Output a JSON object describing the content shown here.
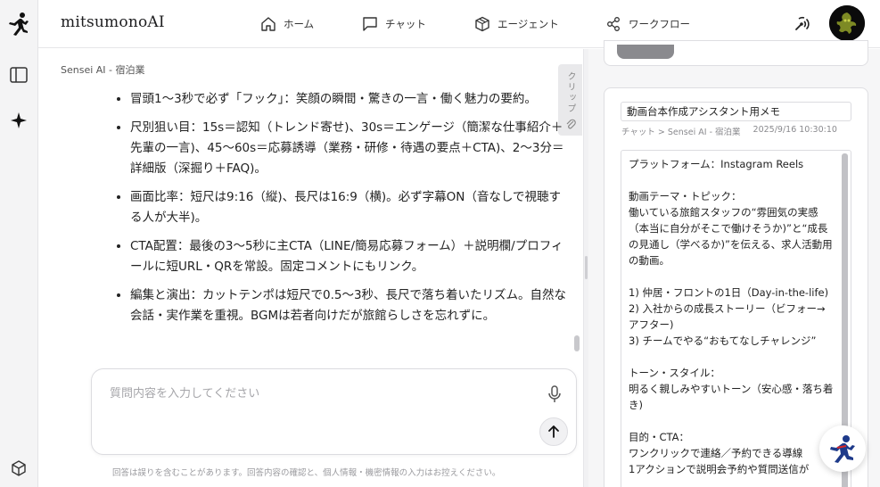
{
  "app": {
    "title": "mitsumonoAI"
  },
  "nav": [
    {
      "label": "ホーム",
      "icon": "home-icon"
    },
    {
      "label": "チャット",
      "icon": "chat-bubble-icon"
    },
    {
      "label": "エージェント",
      "icon": "cube-icon"
    },
    {
      "label": "ワークフロー",
      "icon": "share-nodes-icon"
    }
  ],
  "chat": {
    "breadcrumb": "Sensei AI - 宿泊業",
    "clip_label": "クリップ",
    "messages": [
      "冒頭1〜3秒で必ず「フック」：笑顔の瞬間・驚きの一言・働く魅力の要約。",
      "尺別狙い目：15s＝認知（トレンド寄せ)、30s＝エンゲージ（簡潔な仕事紹介＋先輩の一言)、45〜60s＝応募誘導（業務・研修・待遇の要点＋CTA)、2〜3分＝詳細版（深掘り＋FAQ)。",
      "画面比率：短尺は9:16（縦)、長尺は16:9（横)。必ず字幕ON（音なしで視聴する人が大半)。",
      "CTA配置：最後の3〜5秒に主CTA（LINE/簡易応募フォーム）＋説明欄/プロフィールに短URL・QRを常設。固定コメントにもリンク。",
      "編集と演出：カットテンポは短尺で0.5〜3秒、長尺で落ち着いたリズム。自然な会話・実作業を重視。BGMは若者向けだが旅館らしさを忘れずに。"
    ],
    "input_placeholder": "質問内容を入力してください",
    "disclaimer": "回答は誤りを含むことがあります。回答内容の確認と、個人情報・機密情報の入力はお控えください。"
  },
  "memo": {
    "title": "動画台本作成アシスタント用メモ",
    "path": "チャット > Sensei AI - 宿泊業",
    "timestamp": "2025/9/16 10:30:10",
    "body": "プラットフォーム：Instagram Reels\n\n動画テーマ・トピック：\n働いている旅館スタッフの“雰囲気の実感（本当に自分がそこで働けそうか)”と“成長の見通し（学べるか)”を伝える、求人活動用の動画。\n\n1) 仲居・フロントの1日（Day-in-the-life)\n2) 入社からの成長ストーリー（ビフォー→アフター)\n3) チームでやる“おもてなしチャレンジ”\n\nトーン・スタイル：\n明るく親しみやすいトーン（安心感・落ち着き)\n\n目的・CTA：\nワンクリックで連絡／予約できる導線\n1アクションで説明会予約や質問送信が"
  }
}
